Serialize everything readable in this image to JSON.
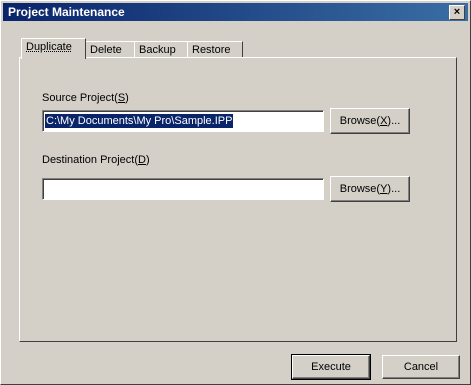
{
  "window": {
    "title": "Project Maintenance",
    "close_glyph": "×"
  },
  "tabs": [
    {
      "label": "Duplicate",
      "active": true
    },
    {
      "label": "Delete",
      "active": false
    },
    {
      "label": "Backup",
      "active": false
    },
    {
      "label": "Restore",
      "active": false
    }
  ],
  "source": {
    "label": "Source Project(",
    "hotkey": "S",
    "label_end": ")",
    "value": "C:\\My Documents\\My Pro\\Sample.IPP",
    "browse_label": "Browse(",
    "browse_hotkey": "X",
    "browse_end": ")..."
  },
  "destination": {
    "label": "Destination Project(",
    "hotkey": "D",
    "label_end": ")",
    "value": "",
    "browse_label": "Browse(",
    "browse_hotkey": "Y",
    "browse_end": ")..."
  },
  "buttons": {
    "execute": "Execute",
    "cancel": "Cancel"
  }
}
